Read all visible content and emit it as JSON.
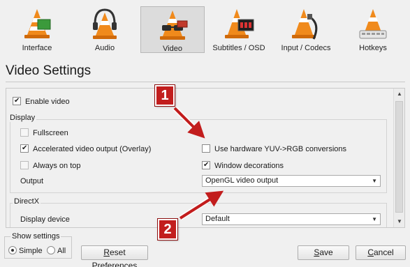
{
  "toolbar": {
    "items": [
      {
        "label": "Interface",
        "icon": "interface-cone-icon",
        "selected": false
      },
      {
        "label": "Audio",
        "icon": "audio-headphones-cone-icon",
        "selected": false
      },
      {
        "label": "Video",
        "icon": "video-glasses-cone-icon",
        "selected": true
      },
      {
        "label": "Subtitles / OSD",
        "icon": "subtitles-display-cone-icon",
        "selected": false
      },
      {
        "label": "Input / Codecs",
        "icon": "input-cable-cone-icon",
        "selected": false
      },
      {
        "label": "Hotkeys",
        "icon": "hotkeys-keyboard-cone-icon",
        "selected": false
      }
    ]
  },
  "page_title": "Video Settings",
  "settings": {
    "enable_video": {
      "label": "Enable video",
      "checked": true
    },
    "display_group": {
      "title": "Display",
      "fullscreen": {
        "label": "Fullscreen",
        "checked": false
      },
      "accelerated": {
        "label": "Accelerated video output (Overlay)",
        "checked": true
      },
      "always_on_top": {
        "label": "Always on top",
        "checked": false
      },
      "hw_yuv": {
        "label": "Use hardware YUV->RGB conversions",
        "checked": false
      },
      "window_decorations": {
        "label": "Window decorations",
        "checked": true
      },
      "output_label": "Output",
      "output_value": "OpenGL video output"
    },
    "directx_group": {
      "title": "DirectX",
      "display_device_label": "Display device",
      "display_device_value": "Default"
    }
  },
  "footer": {
    "show_settings": {
      "legend": "Show settings",
      "simple": "Simple",
      "all": "All",
      "selected": "Simple"
    },
    "reset_label": "Reset Preferences",
    "save_label": "Save",
    "cancel_label": "Cancel"
  },
  "annotations": {
    "badge_1": "1",
    "badge_2": "2",
    "color": "#c21d1d"
  }
}
